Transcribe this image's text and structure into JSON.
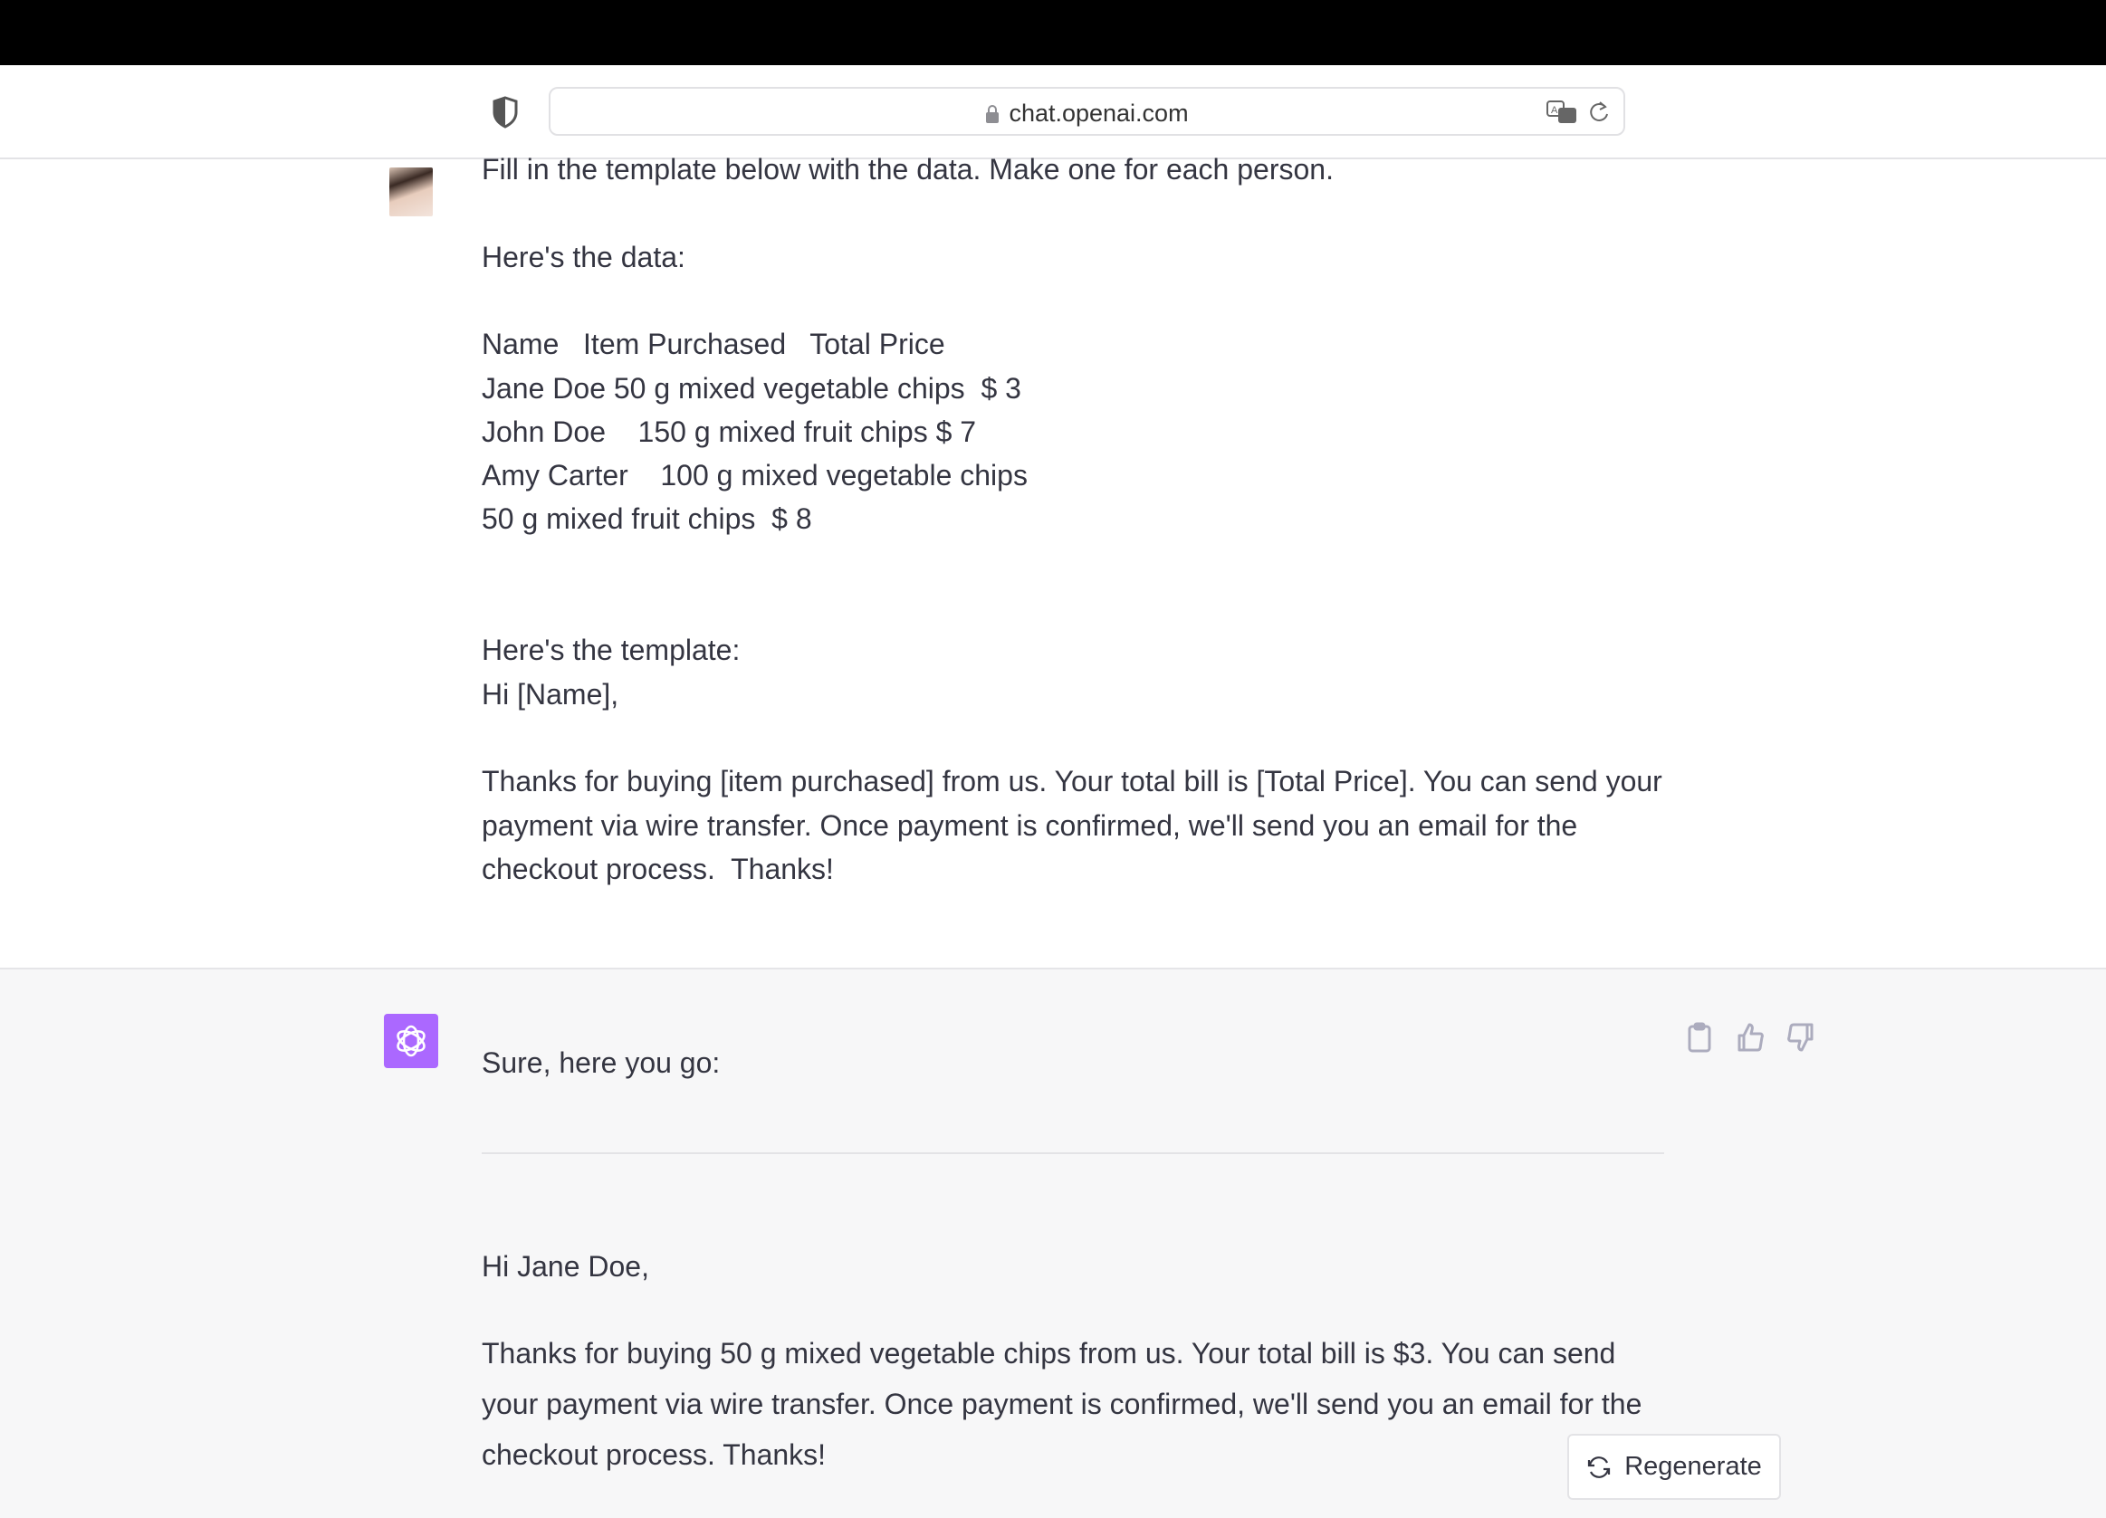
{
  "browser": {
    "url": "chat.openai.com"
  },
  "user_message": {
    "lines": [
      "Fill in the template below with the data. Make one for each person.",
      "",
      "Here's the data:",
      "",
      "Name   Item Purchased   Total Price",
      "Jane Doe 50 g mixed vegetable chips  $ 3",
      "John Doe    150 g mixed fruit chips $ 7",
      "Amy Carter    100 g mixed vegetable chips",
      "50 g mixed fruit chips  $ 8",
      "",
      "",
      "Here's the template:",
      "Hi [Name],",
      "",
      "Thanks for buying [item purchased] from us. Your total bill is [Total Price]. You can send your",
      "payment via wire transfer. Once payment is confirmed, we'll send you an email for the",
      "checkout process.  Thanks!"
    ]
  },
  "assistant_message": {
    "intro": "Sure, here you go:",
    "greeting": "Hi Jane Doe,",
    "body": "Thanks for buying 50 g mixed vegetable chips from us. Your total bill is $3. You can send your payment via wire transfer. Once payment is confirmed, we'll send you an email for the checkout process. Thanks!",
    "accent_color": "#ab68ff"
  },
  "regenerate_label": "Regenerate"
}
